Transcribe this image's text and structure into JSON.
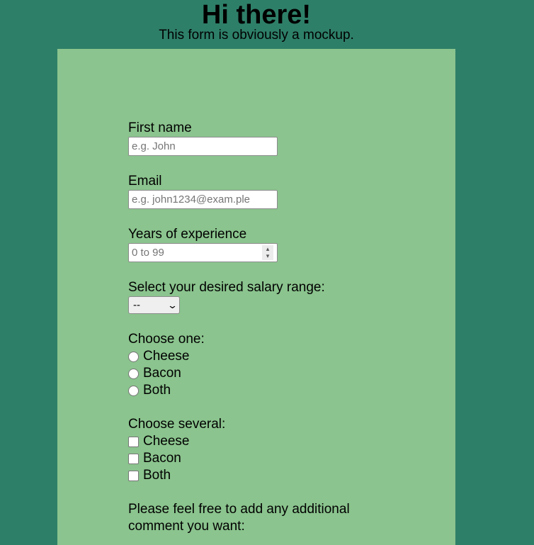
{
  "header": {
    "title": "Hi there!",
    "subtitle": "This form is obviously a mockup."
  },
  "form": {
    "first_name": {
      "label": "First name",
      "placeholder": "e.g. John",
      "value": ""
    },
    "email": {
      "label": "Email",
      "placeholder": "e.g. john1234@exam.ple",
      "value": ""
    },
    "experience": {
      "label": "Years of experience",
      "placeholder": "0 to 99",
      "value": ""
    },
    "salary": {
      "label": "Select your desired salary range:",
      "selected": "--"
    },
    "choose_one": {
      "label": "Choose one:",
      "options": [
        "Cheese",
        "Bacon",
        "Both"
      ]
    },
    "choose_several": {
      "label": "Choose several:",
      "options": [
        "Cheese",
        "Bacon",
        "Both"
      ]
    },
    "comment": {
      "label": "Please feel free to add any additional comment you want:"
    }
  },
  "colors": {
    "page_background": "#2e7f68",
    "panel_background": "#8bc48e"
  }
}
